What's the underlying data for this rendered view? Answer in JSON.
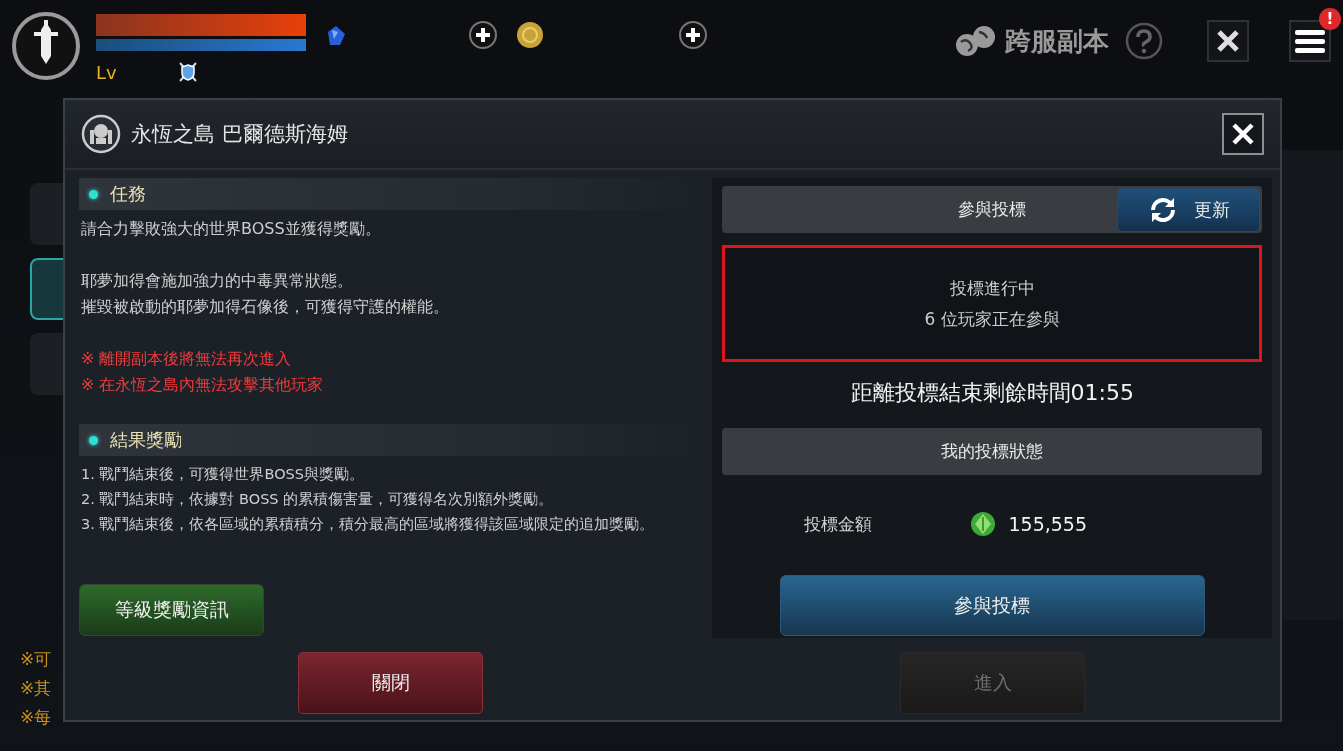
{
  "hud": {
    "hp_bar": {
      "level": 1
    },
    "mp_bar": {
      "level": 1
    },
    "level_label": "Lv",
    "mode_title": "跨服副本",
    "menu_badge": "!"
  },
  "background": {
    "side_tabs": [
      {
        "selected": false
      },
      {
        "selected": true
      },
      {
        "selected": false
      }
    ],
    "notes": [
      "※可",
      "※其",
      "※每"
    ]
  },
  "dialog": {
    "title": "永恆之島 巴爾德斯海姆",
    "sections": [
      {
        "heading": "任務",
        "blocks": [
          [
            {
              "text": "請合力擊敗強大的世界BOSS並獲得獎勵。",
              "kind": "normal"
            }
          ],
          [
            {
              "text": "耶夢加得會施加強力的中毒異常狀態。",
              "kind": "normal"
            },
            {
              "text": "摧毀被啟動的耶夢加得石像後，可獲得守護的權能。",
              "kind": "normal"
            }
          ],
          [
            {
              "text": "※ 離開副本後將無法再次進入",
              "kind": "warning"
            },
            {
              "text": "※ 在永恆之島內無法攻擊其他玩家",
              "kind": "warning"
            }
          ]
        ]
      },
      {
        "heading": "結果獎勵",
        "blocks": [
          [
            {
              "text": "1. 戰鬥結束後，可獲得世界BOSS與獎勵。",
              "kind": "small"
            },
            {
              "text": "2. 戰鬥結束時，依據對 BOSS 的累積傷害量，可獲得名次別額外獎勵。",
              "kind": "small"
            },
            {
              "text": "3. 戰鬥結束後，依各區域的累積積分，積分最高的區域將獲得該區域限定的追加獎勵。",
              "kind": "small"
            }
          ]
        ]
      }
    ],
    "reward_button": "等級獎勵資訊",
    "bid": {
      "title": "參與投標",
      "refresh_button": "更新",
      "highlighted": true,
      "status_lines": [
        "投標進行中",
        "6 位玩家正在參與"
      ],
      "countdown": "距離投標結束剩餘時間01:55",
      "my_status_title": "我的投標狀態",
      "amount_label": "投標金額",
      "amount": "155,555",
      "bid_button": "參與投標"
    },
    "footer_buttons": [
      {
        "label": "關閉",
        "kind": "close",
        "disabled": false
      },
      {
        "label": "進入",
        "kind": "enter",
        "disabled": true
      }
    ]
  }
}
